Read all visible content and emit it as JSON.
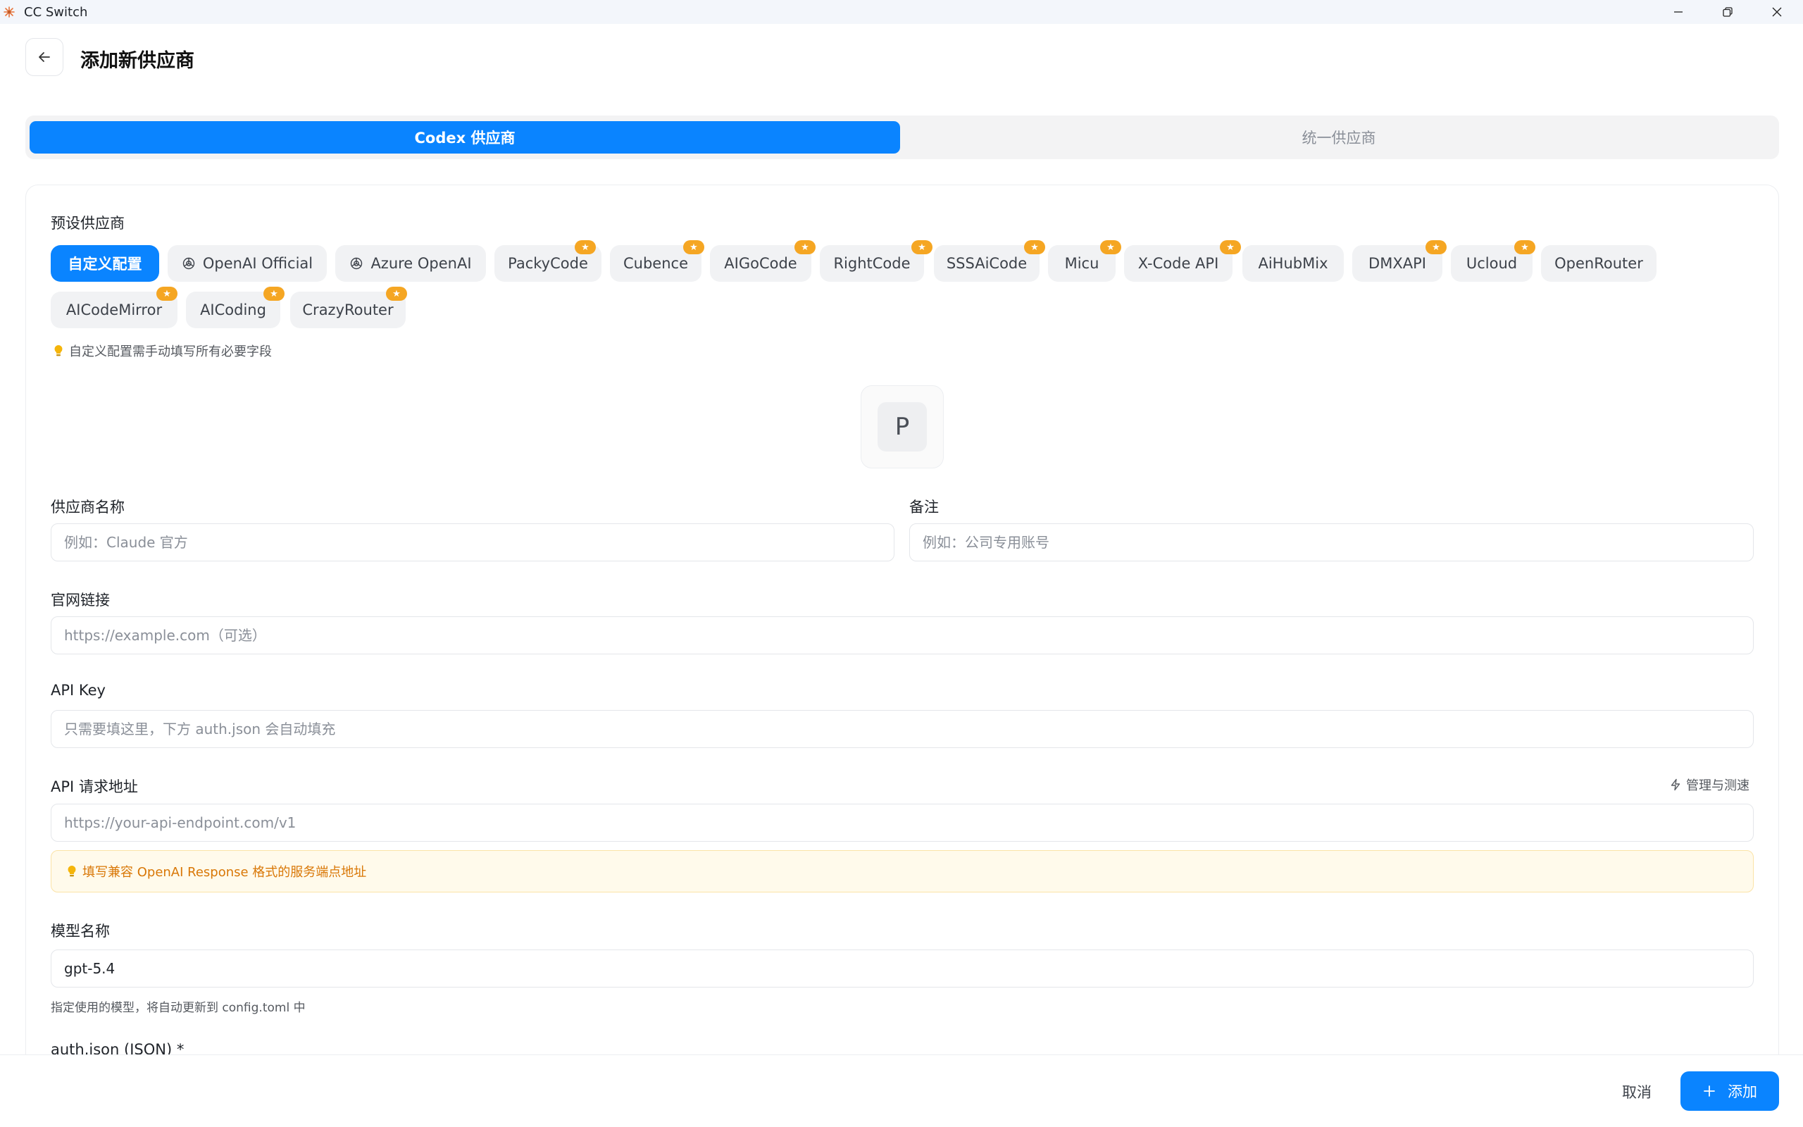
{
  "window": {
    "title": "CC Switch"
  },
  "header": {
    "title": "添加新供应商"
  },
  "tabs": [
    {
      "label": "Codex 供应商",
      "active": true
    },
    {
      "label": "统一供应商",
      "active": false
    }
  ],
  "presets": {
    "label": "预设供应商",
    "items": [
      {
        "label": "自定义配置",
        "active": true,
        "icon": "",
        "starred": false
      },
      {
        "label": "OpenAI Official",
        "icon": "openai-icon",
        "starred": false
      },
      {
        "label": "Azure OpenAI",
        "icon": "openai-icon",
        "starred": false
      },
      {
        "label": "PackyCode",
        "starred": true
      },
      {
        "label": "Cubence",
        "starred": true
      },
      {
        "label": "AIGoCode",
        "starred": true
      },
      {
        "label": "RightCode",
        "starred": true
      },
      {
        "label": "SSSAiCode",
        "starred": true
      },
      {
        "label": "Micu",
        "starred": true
      },
      {
        "label": "X-Code API",
        "starred": true
      },
      {
        "label": "AiHubMix",
        "starred": false
      },
      {
        "label": "DMXAPI",
        "starred": true
      },
      {
        "label": "Ucloud",
        "starred": true
      },
      {
        "label": "OpenRouter",
        "starred": false
      },
      {
        "label": "AICodeMirror",
        "starred": true
      },
      {
        "label": "AICoding",
        "starred": true
      },
      {
        "label": "CrazyRouter",
        "starred": true
      }
    ],
    "hint": "自定义配置需手动填写所有必要字段"
  },
  "avatar": {
    "letter": "P"
  },
  "form": {
    "name": {
      "label": "供应商名称",
      "placeholder": "例如：Claude 官方"
    },
    "note": {
      "label": "备注",
      "placeholder": "例如：公司专用账号"
    },
    "website": {
      "label": "官网链接",
      "placeholder": "https://example.com（可选）"
    },
    "api_key": {
      "label": "API Key",
      "placeholder": "只需要填这里，下方 auth.json 会自动填充"
    },
    "endpoint": {
      "label": "API 请求地址",
      "manage_label": "管理与测速",
      "placeholder": "https://your-api-endpoint.com/v1",
      "warning": "填写兼容 OpenAI Response 格式的服务端点地址"
    },
    "model": {
      "label": "模型名称",
      "value": "gpt-5.4",
      "helper": "指定使用的模型，将自动更新到 config.toml 中"
    },
    "auth_json": {
      "label": "auth.json (JSON) *"
    }
  },
  "footer": {
    "cancel_label": "取消",
    "add_label": "添加"
  },
  "colors": {
    "accent": "#0a84ff",
    "star_badge": "#f5a623",
    "warning_text": "#d97706",
    "warning_bg": "#fffaeb"
  }
}
